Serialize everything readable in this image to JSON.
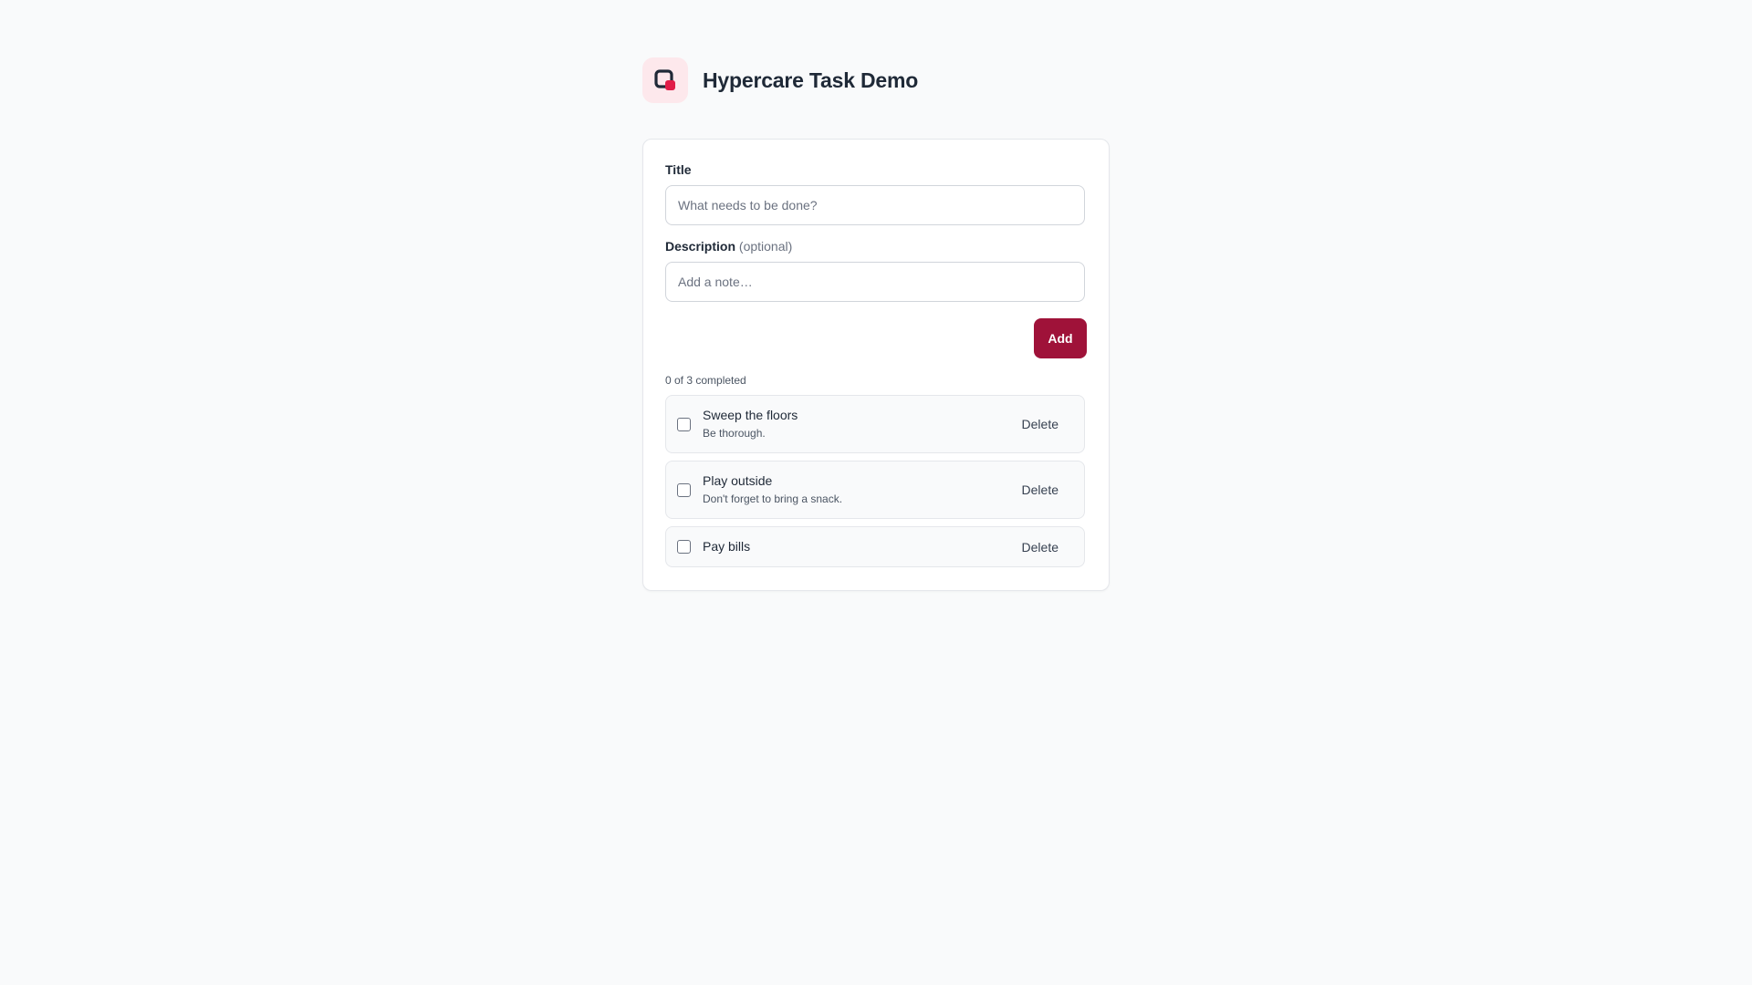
{
  "app": {
    "title": "Hypercare Task Demo",
    "logo_icon": "hypercare-logo-icon",
    "accent_color": "#9f1239"
  },
  "form": {
    "title_label": "Title",
    "title_placeholder": "What needs to be done?",
    "title_value": "",
    "description_label": "Description",
    "description_optional": "(optional)",
    "description_placeholder": "Add a note…",
    "description_value": "",
    "add_label": "Add"
  },
  "status": {
    "text": "0 of 3 completed"
  },
  "tasks": [
    {
      "title": "Sweep the floors",
      "description": "Be thorough.",
      "completed": false,
      "delete_label": "Delete"
    },
    {
      "title": "Play outside",
      "description": "Don't forget to bring a snack.",
      "completed": false,
      "delete_label": "Delete"
    },
    {
      "title": "Pay bills",
      "description": "",
      "completed": false,
      "delete_label": "Delete"
    }
  ]
}
